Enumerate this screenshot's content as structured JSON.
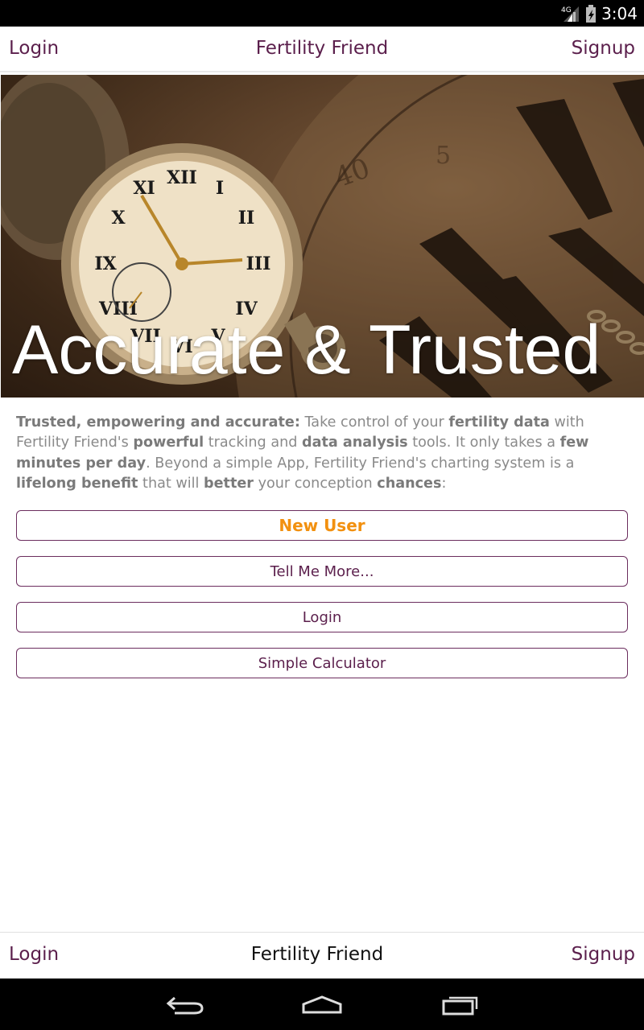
{
  "status_bar": {
    "network": "4G",
    "time": "3:04",
    "icons": [
      "signal-icon",
      "battery-icon"
    ]
  },
  "top_nav": {
    "left_link": "Login",
    "title": "Fertility Friend",
    "right_link": "Signup"
  },
  "hero": {
    "title": "Accurate & Trusted",
    "image": "pocket-watch-clock-image"
  },
  "description": {
    "segments": [
      {
        "text": "Trusted, empowering and accurate:",
        "bold": true
      },
      {
        "text": " Take control of your ",
        "bold": false
      },
      {
        "text": "fertility data",
        "bold": true
      },
      {
        "text": " with Fertility Friend's ",
        "bold": false
      },
      {
        "text": "powerful",
        "bold": true
      },
      {
        "text": " tracking and ",
        "bold": false
      },
      {
        "text": "data analysis",
        "bold": true
      },
      {
        "text": " tools. It only takes a ",
        "bold": false
      },
      {
        "text": "few minutes per day",
        "bold": true
      },
      {
        "text": ". Beyond a simple App, Fertility Friend's charting system is a ",
        "bold": false
      },
      {
        "text": "lifelong benefit",
        "bold": true
      },
      {
        "text": " that will ",
        "bold": false
      },
      {
        "text": "better",
        "bold": true
      },
      {
        "text": " your conception ",
        "bold": false
      },
      {
        "text": "chances",
        "bold": true
      },
      {
        "text": ":",
        "bold": false
      }
    ]
  },
  "buttons": {
    "new_user": "New User",
    "tell_me_more": "Tell Me More...",
    "login": "Login",
    "simple_calculator": "Simple Calculator"
  },
  "bottom_nav": {
    "left_link": "Login",
    "title": "Fertility Friend",
    "right_link": "Signup"
  },
  "system_nav": {
    "icons": [
      "back-icon",
      "home-icon",
      "recent-apps-icon"
    ]
  },
  "colors": {
    "brand": "#5b1f4c",
    "accent": "#f2900f",
    "text_muted": "#8a8a8a"
  }
}
